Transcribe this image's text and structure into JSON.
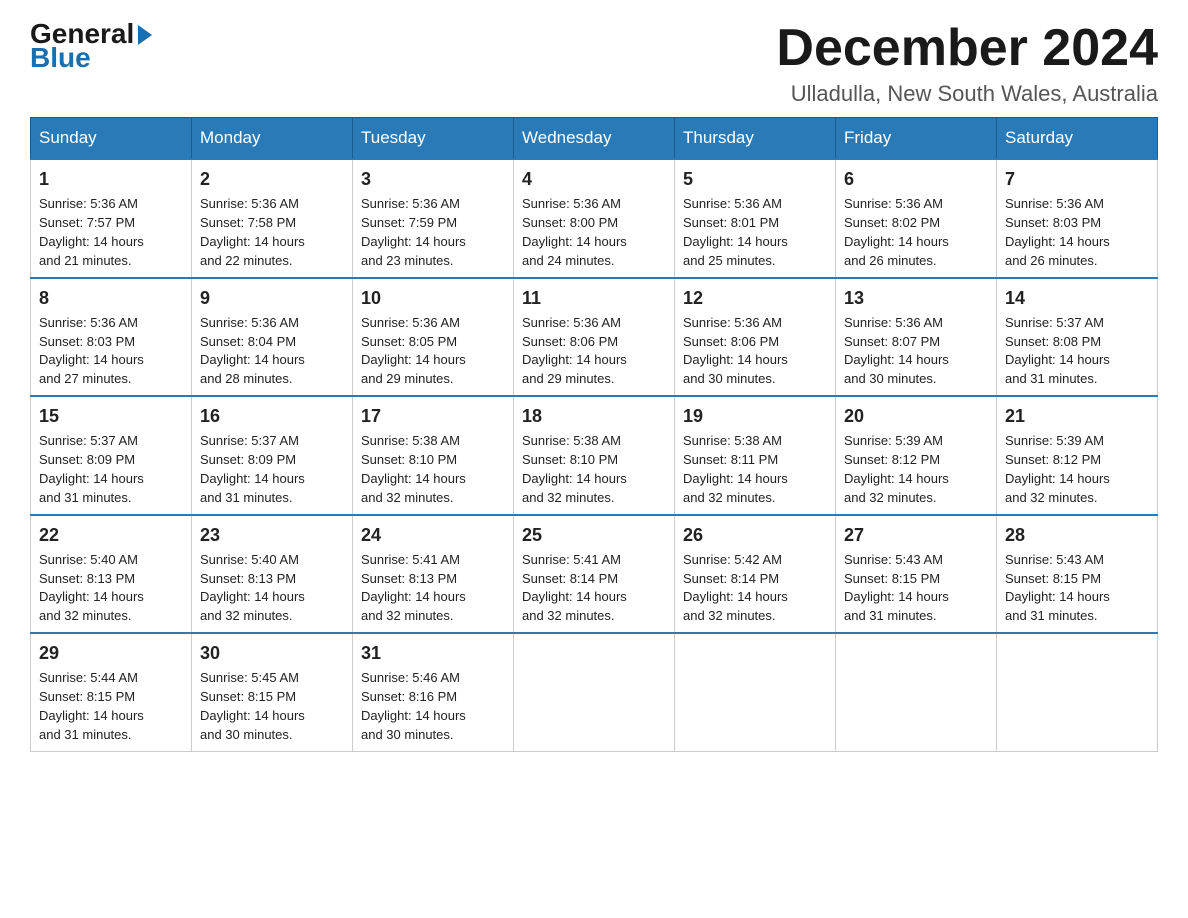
{
  "logo": {
    "general": "General",
    "blue": "Blue"
  },
  "header": {
    "month": "December 2024",
    "location": "Ulladulla, New South Wales, Australia"
  },
  "weekdays": [
    "Sunday",
    "Monday",
    "Tuesday",
    "Wednesday",
    "Thursday",
    "Friday",
    "Saturday"
  ],
  "weeks": [
    [
      {
        "day": "1",
        "sunrise": "5:36 AM",
        "sunset": "7:57 PM",
        "daylight": "14 hours and 21 minutes."
      },
      {
        "day": "2",
        "sunrise": "5:36 AM",
        "sunset": "7:58 PM",
        "daylight": "14 hours and 22 minutes."
      },
      {
        "day": "3",
        "sunrise": "5:36 AM",
        "sunset": "7:59 PM",
        "daylight": "14 hours and 23 minutes."
      },
      {
        "day": "4",
        "sunrise": "5:36 AM",
        "sunset": "8:00 PM",
        "daylight": "14 hours and 24 minutes."
      },
      {
        "day": "5",
        "sunrise": "5:36 AM",
        "sunset": "8:01 PM",
        "daylight": "14 hours and 25 minutes."
      },
      {
        "day": "6",
        "sunrise": "5:36 AM",
        "sunset": "8:02 PM",
        "daylight": "14 hours and 26 minutes."
      },
      {
        "day": "7",
        "sunrise": "5:36 AM",
        "sunset": "8:03 PM",
        "daylight": "14 hours and 26 minutes."
      }
    ],
    [
      {
        "day": "8",
        "sunrise": "5:36 AM",
        "sunset": "8:03 PM",
        "daylight": "14 hours and 27 minutes."
      },
      {
        "day": "9",
        "sunrise": "5:36 AM",
        "sunset": "8:04 PM",
        "daylight": "14 hours and 28 minutes."
      },
      {
        "day": "10",
        "sunrise": "5:36 AM",
        "sunset": "8:05 PM",
        "daylight": "14 hours and 29 minutes."
      },
      {
        "day": "11",
        "sunrise": "5:36 AM",
        "sunset": "8:06 PM",
        "daylight": "14 hours and 29 minutes."
      },
      {
        "day": "12",
        "sunrise": "5:36 AM",
        "sunset": "8:06 PM",
        "daylight": "14 hours and 30 minutes."
      },
      {
        "day": "13",
        "sunrise": "5:36 AM",
        "sunset": "8:07 PM",
        "daylight": "14 hours and 30 minutes."
      },
      {
        "day": "14",
        "sunrise": "5:37 AM",
        "sunset": "8:08 PM",
        "daylight": "14 hours and 31 minutes."
      }
    ],
    [
      {
        "day": "15",
        "sunrise": "5:37 AM",
        "sunset": "8:09 PM",
        "daylight": "14 hours and 31 minutes."
      },
      {
        "day": "16",
        "sunrise": "5:37 AM",
        "sunset": "8:09 PM",
        "daylight": "14 hours and 31 minutes."
      },
      {
        "day": "17",
        "sunrise": "5:38 AM",
        "sunset": "8:10 PM",
        "daylight": "14 hours and 32 minutes."
      },
      {
        "day": "18",
        "sunrise": "5:38 AM",
        "sunset": "8:10 PM",
        "daylight": "14 hours and 32 minutes."
      },
      {
        "day": "19",
        "sunrise": "5:38 AM",
        "sunset": "8:11 PM",
        "daylight": "14 hours and 32 minutes."
      },
      {
        "day": "20",
        "sunrise": "5:39 AM",
        "sunset": "8:12 PM",
        "daylight": "14 hours and 32 minutes."
      },
      {
        "day": "21",
        "sunrise": "5:39 AM",
        "sunset": "8:12 PM",
        "daylight": "14 hours and 32 minutes."
      }
    ],
    [
      {
        "day": "22",
        "sunrise": "5:40 AM",
        "sunset": "8:13 PM",
        "daylight": "14 hours and 32 minutes."
      },
      {
        "day": "23",
        "sunrise": "5:40 AM",
        "sunset": "8:13 PM",
        "daylight": "14 hours and 32 minutes."
      },
      {
        "day": "24",
        "sunrise": "5:41 AM",
        "sunset": "8:13 PM",
        "daylight": "14 hours and 32 minutes."
      },
      {
        "day": "25",
        "sunrise": "5:41 AM",
        "sunset": "8:14 PM",
        "daylight": "14 hours and 32 minutes."
      },
      {
        "day": "26",
        "sunrise": "5:42 AM",
        "sunset": "8:14 PM",
        "daylight": "14 hours and 32 minutes."
      },
      {
        "day": "27",
        "sunrise": "5:43 AM",
        "sunset": "8:15 PM",
        "daylight": "14 hours and 31 minutes."
      },
      {
        "day": "28",
        "sunrise": "5:43 AM",
        "sunset": "8:15 PM",
        "daylight": "14 hours and 31 minutes."
      }
    ],
    [
      {
        "day": "29",
        "sunrise": "5:44 AM",
        "sunset": "8:15 PM",
        "daylight": "14 hours and 31 minutes."
      },
      {
        "day": "30",
        "sunrise": "5:45 AM",
        "sunset": "8:15 PM",
        "daylight": "14 hours and 30 minutes."
      },
      {
        "day": "31",
        "sunrise": "5:46 AM",
        "sunset": "8:16 PM",
        "daylight": "14 hours and 30 minutes."
      },
      null,
      null,
      null,
      null
    ]
  ],
  "labels": {
    "sunrise": "Sunrise:",
    "sunset": "Sunset:",
    "daylight": "Daylight:"
  }
}
